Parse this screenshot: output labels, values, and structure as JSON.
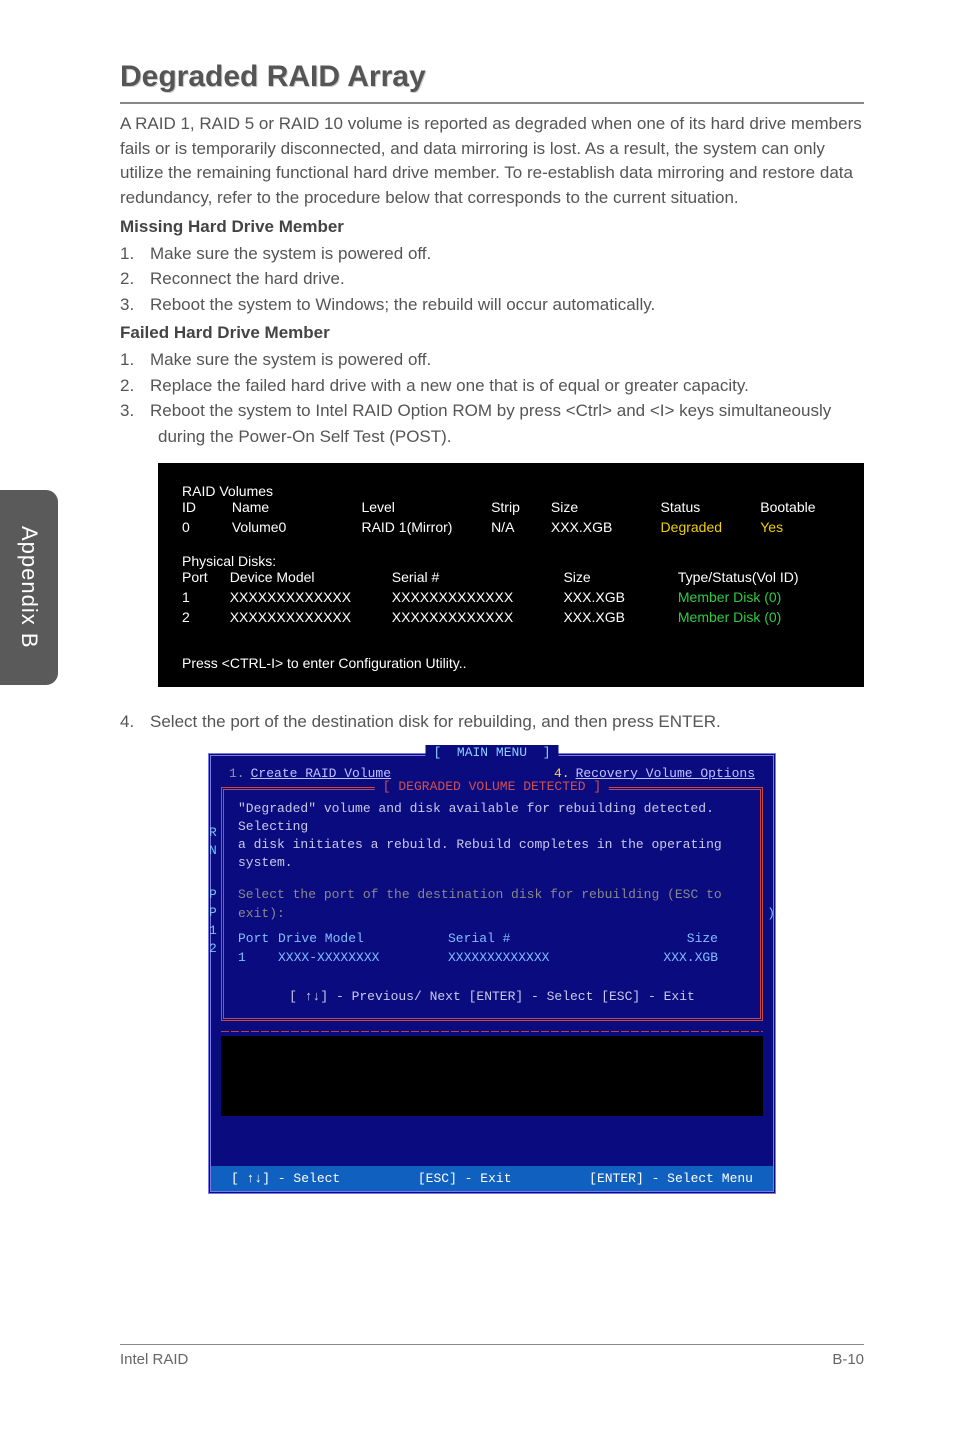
{
  "sidetab": "Appendix B",
  "heading": "Degraded RAID Array",
  "intro": "A RAID 1, RAID 5 or RAID 10 volume is reported as degraded when one of its hard drive members fails or is temporarily disconnected, and data mirroring is lost. As a result, the system can only utilize the remaining functional hard drive member. To re-establish data mirroring and restore data redundancy, refer to the procedure below that corresponds to the current situation.",
  "sub1": "Missing Hard Drive Member",
  "list1": {
    "n1": "1.",
    "i1": "Make sure the system is powered off.",
    "n2": "2.",
    "i2": "Reconnect the hard drive.",
    "n3": "3.",
    "i3": "Reboot the system to Windows; the rebuild will occur automatically."
  },
  "sub2": "Failed Hard Drive Member",
  "list2": {
    "n1": "1.",
    "i1": "Make sure the system is powered off.",
    "n2": "2.",
    "i2": "Replace the failed hard drive with a new one that is of equal or greater capacity.",
    "n3": "3.",
    "i3": "Reboot the system to Intel RAID Option ROM by press <Ctrl> and <I> keys simultaneously during the Power-On Self Test (POST)."
  },
  "box1": {
    "t_raid": "RAID Volumes",
    "h_id": "ID",
    "h_name": "Name",
    "h_level": "Level",
    "h_strip": "Strip",
    "h_size": "Size",
    "h_status": "Status",
    "h_boot": "Bootable",
    "r_id": "0",
    "r_name": "Volume0",
    "r_level": "RAID 1(Mirror)",
    "r_strip": "N/A",
    "r_size": "XXX.XGB",
    "r_status": "Degraded",
    "r_boot": "Yes",
    "t_phys": "Physical Disks:",
    "p_port": "Port",
    "p_model": "Device Model",
    "p_serial": "Serial #",
    "p_size": "Size",
    "p_type": "Type/Status(Vol ID)",
    "r1_port": "1",
    "r1_model": "XXXXXXXXXXXXX",
    "r1_serial": "XXXXXXXXXXXXX",
    "r1_size": "XXX.XGB",
    "r1_type": "Member  Disk (0)",
    "r2_port": "2",
    "r2_model": "XXXXXXXXXXXXX",
    "r2_serial": "XXXXXXXXXXXXX",
    "r2_size": "XXX.XGB",
    "r2_type": "Member  Disk (0)",
    "press": "Press  <CTRL-I>  to enter Configuration Utility.."
  },
  "step4": {
    "n": "4.",
    "t": "Select the port of the destination disk for rebuilding, and then press ENTER."
  },
  "menu": {
    "title": "MAIN  MENU",
    "item1n": "1.",
    "item1": "Create  RAID  Volume",
    "item4n": "4.",
    "item4": "Recovery Volume  Options",
    "innert": "DEGRADED VOLUME DETECTED",
    "msg1": "\"Degraded\" volume and disk available for rebuilding detected. Selecting",
    "msg2": "a disk initiates a rebuild. Rebuild completes in the  operating system.",
    "msg3": "Select the port of the destination disk for rebuilding (ESC to exit):",
    "h_port": "Port",
    "h_drive": "Drive  Model",
    "h_serial": "Serial  #",
    "h_size": "Size",
    "d_port": "1",
    "d_model": "XXXX-XXXXXXXX",
    "d_serial": "XXXXXXXXXXXXX",
    "d_size": "XXX.XGB",
    "keybar": "[ ↑↓] - Previous/ Next      [ENTER] - Select     [ESC] - Exit",
    "bar1": "[ ↑↓] - Select",
    "bar2": "[ESC] - Exit",
    "bar3": "[ENTER] - Select Menu"
  },
  "footer": {
    "left": "Intel RAID",
    "right": "B-10"
  }
}
